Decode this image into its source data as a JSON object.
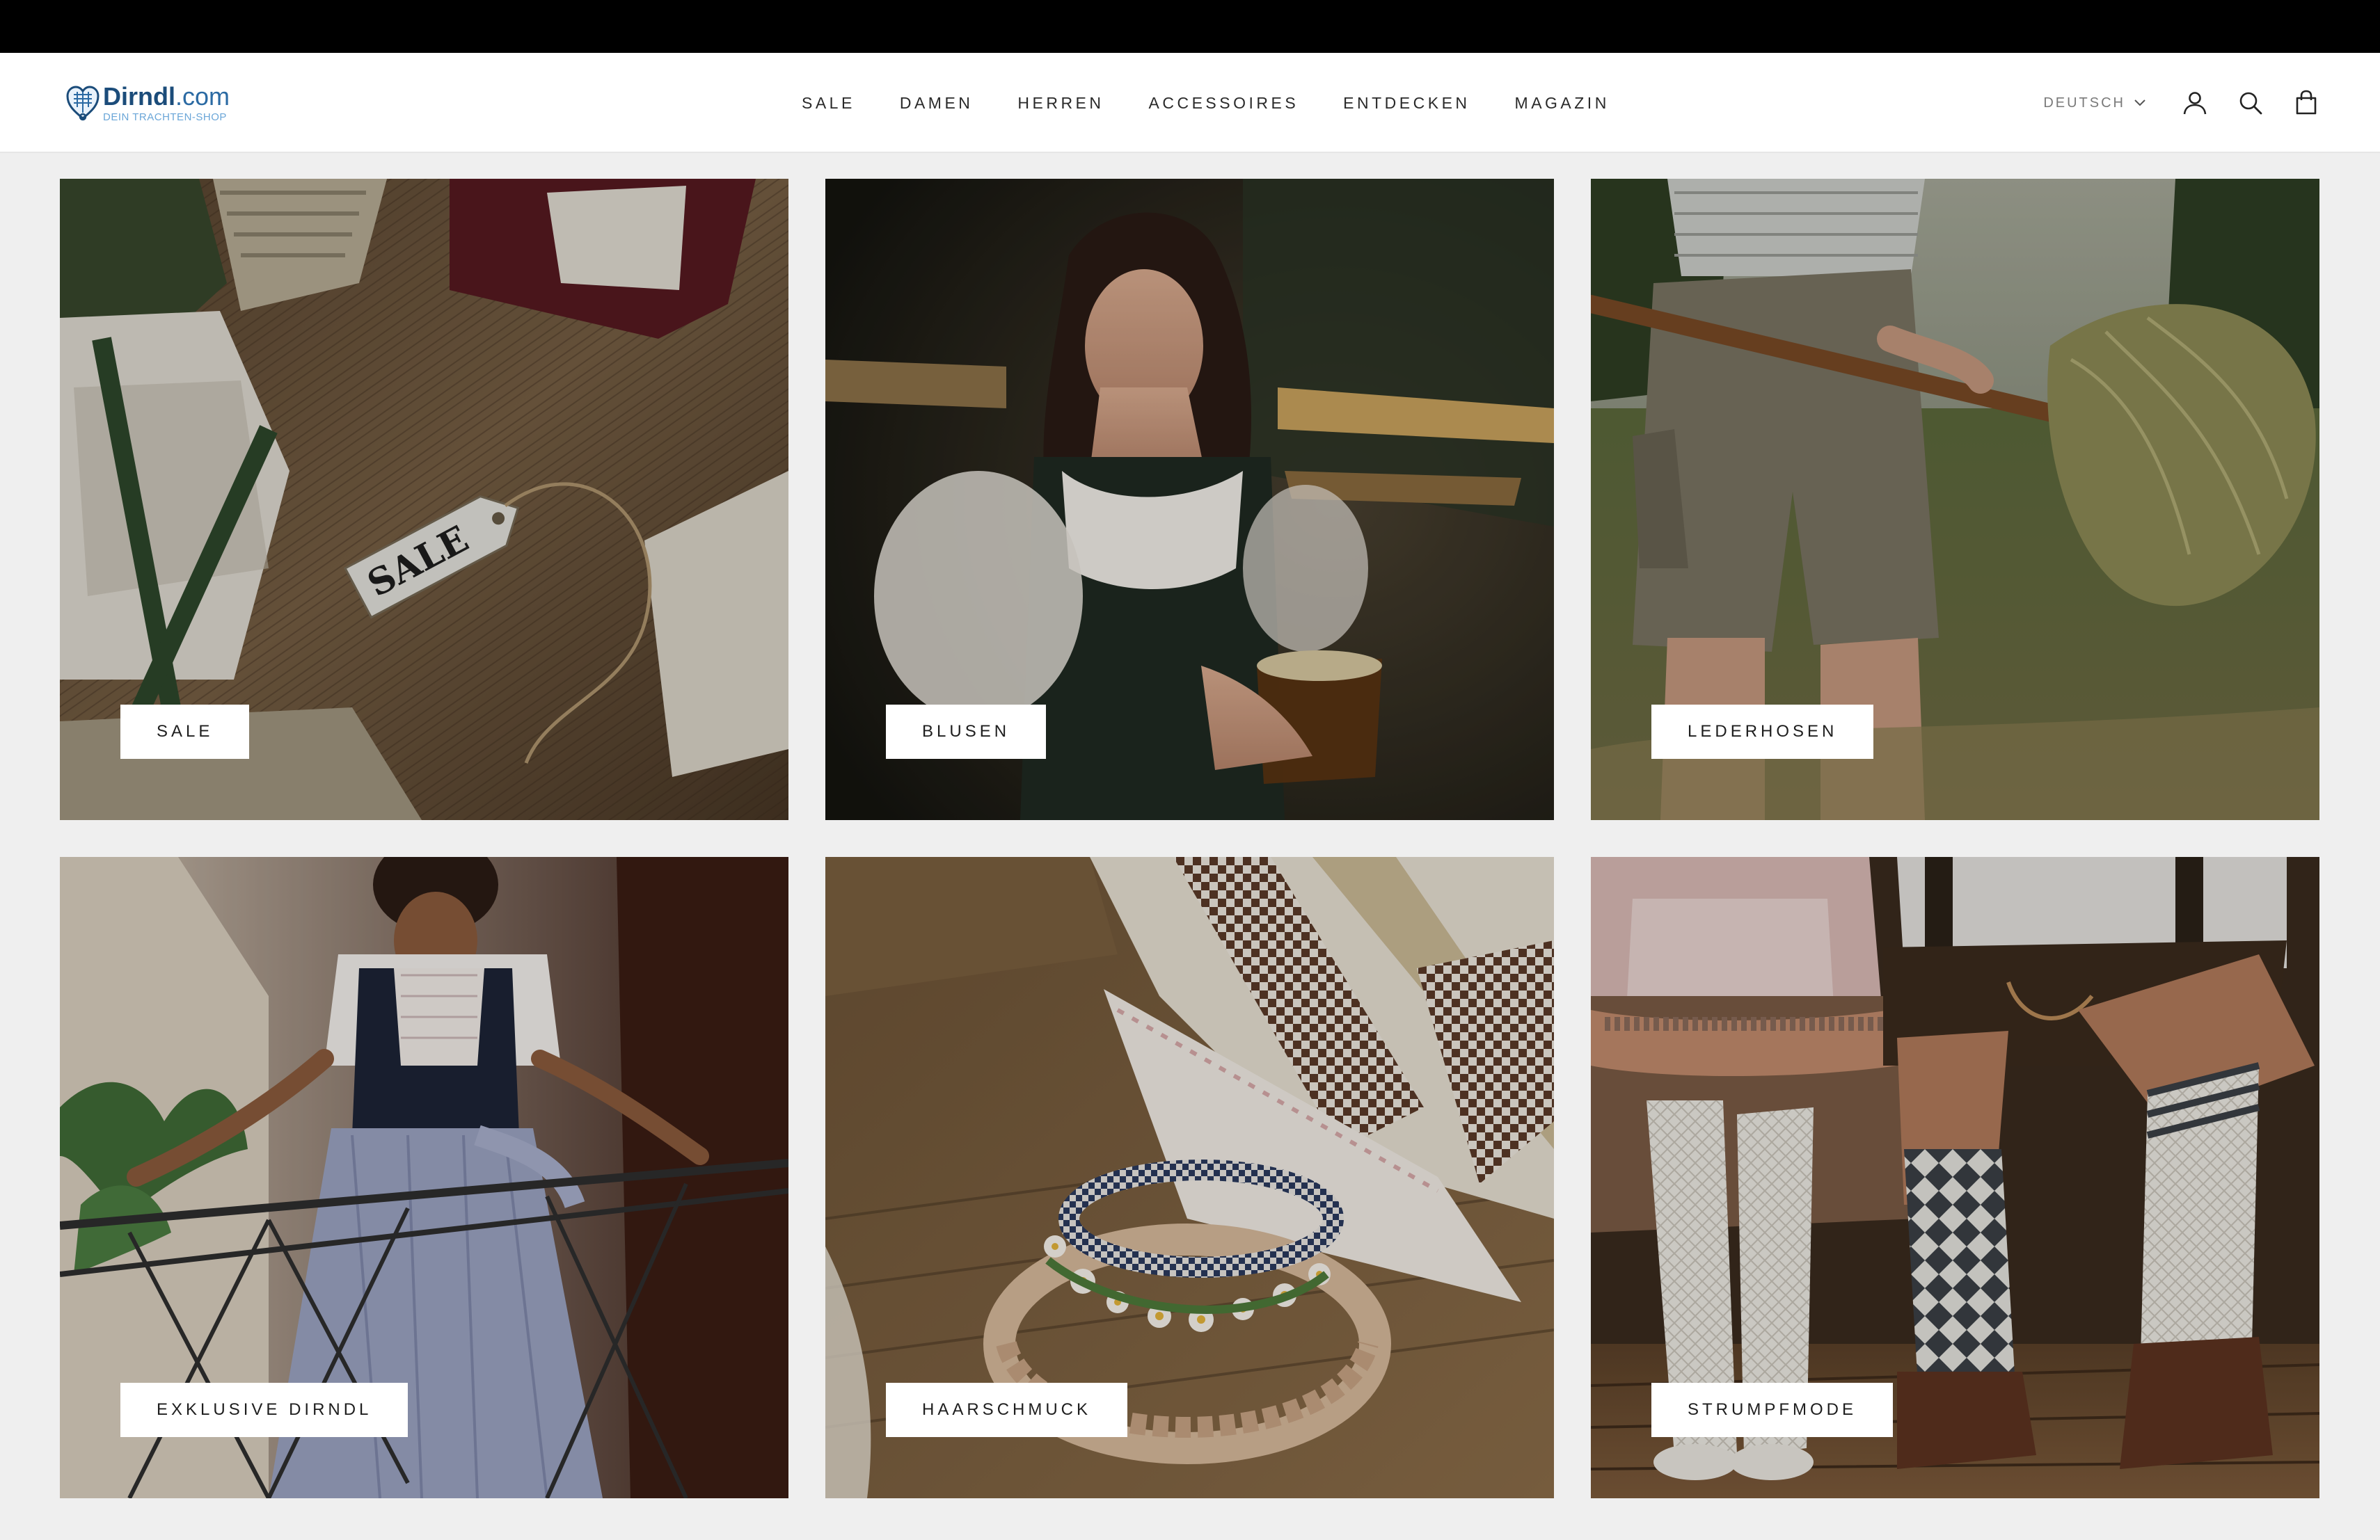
{
  "colors": {
    "topbar": "#000000",
    "header_bg": "#ffffff",
    "page_bg": "#efefef",
    "brand_blue": "#1b4c7a"
  },
  "logo": {
    "name": "Dirndl",
    "tld": ".com",
    "tagline": "DEIN TRACHTEN-SHOP"
  },
  "nav": {
    "items": [
      {
        "label": "SALE"
      },
      {
        "label": "DAMEN"
      },
      {
        "label": "HERREN"
      },
      {
        "label": "ACCESSOIRES"
      },
      {
        "label": "ENTDECKEN"
      },
      {
        "label": "MAGAZIN"
      }
    ]
  },
  "header_actions": {
    "language": "DEUTSCH",
    "icons": [
      "user-icon",
      "search-icon",
      "cart-icon"
    ]
  },
  "categories": [
    {
      "label": "SALE",
      "image": "sale-tag-clothing-photo"
    },
    {
      "label": "BLUSEN",
      "image": "woman-in-dirndl-photo"
    },
    {
      "label": "LEDERHOSEN",
      "image": "man-in-lederhosen-photo"
    },
    {
      "label": "EXKLUSIVE DIRNDL",
      "image": "exclusive-dirndl-photo"
    },
    {
      "label": "HAARSCHMUCK",
      "image": "flower-headband-photo"
    },
    {
      "label": "STRUMPFMODE",
      "image": "traditional-socks-photo"
    }
  ]
}
